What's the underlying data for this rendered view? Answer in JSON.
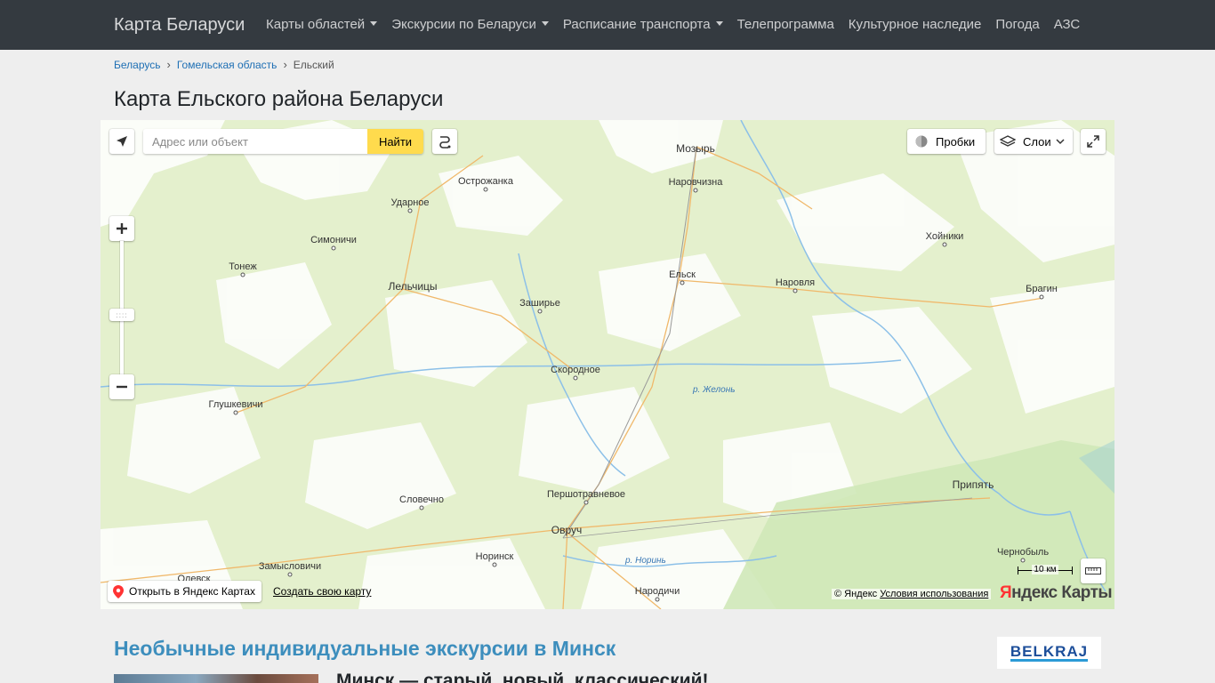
{
  "navbar": {
    "brand": "Карта Беларуси",
    "items": [
      {
        "label": "Карты областей",
        "dropdown": true
      },
      {
        "label": "Экскурсии по Беларуси",
        "dropdown": true
      },
      {
        "label": "Расписание транспорта",
        "dropdown": true
      },
      {
        "label": "Телепрограмма",
        "dropdown": false
      },
      {
        "label": "Культурное наследие",
        "dropdown": false
      },
      {
        "label": "Погода",
        "dropdown": false
      },
      {
        "label": "АЗС",
        "dropdown": false
      }
    ]
  },
  "breadcrumb": {
    "items": [
      "Беларусь",
      "Гомельская область"
    ],
    "current": "Ельский"
  },
  "page_title": "Карта Ельского района Беларуси",
  "map": {
    "search_placeholder": "Адрес или объект",
    "search_button": "Найти",
    "traffic_label": "Пробки",
    "layers_label": "Слои",
    "open_in_yandex": "Открыть в Яндекс Картах",
    "create_map": "Создать свою карту",
    "scale_label": "10 км",
    "copyright": "© Яндекс",
    "terms": "Условия использования",
    "logo_y": "Я",
    "logo_rest": "ндекс Карты",
    "places": [
      {
        "name": "Мозырь",
        "major": true
      },
      {
        "name": "Наровчизна",
        "major": false
      },
      {
        "name": "Остро­жанка",
        "major": false
      },
      {
        "name": "Ударное",
        "major": false
      },
      {
        "name": "Симоничи",
        "major": false
      },
      {
        "name": "Тонеж",
        "major": false
      },
      {
        "name": "Лельчицы",
        "major": true
      },
      {
        "name": "Заширье",
        "major": false
      },
      {
        "name": "Ельск",
        "major": false
      },
      {
        "name": "Наровля",
        "major": false
      },
      {
        "name": "Хойники",
        "major": false
      },
      {
        "name": "Брагин",
        "major": false
      },
      {
        "name": "Скородное",
        "major": false
      },
      {
        "name": "Глушкевичи",
        "major": false
      },
      {
        "name": "Словечно",
        "major": false
      },
      {
        "name": "Першотравневое",
        "major": false
      },
      {
        "name": "Овруч",
        "major": true
      },
      {
        "name": "Норинск",
        "major": false
      },
      {
        "name": "Замысловичи",
        "major": false
      },
      {
        "name": "Олевск",
        "major": false
      },
      {
        "name": "Народичи",
        "major": false
      },
      {
        "name": "Припять",
        "major": true
      },
      {
        "name": "Чернобыль",
        "major": false
      }
    ],
    "rivers": [
      "р. Желонь",
      "р. Норинь"
    ]
  },
  "promo": {
    "title": "Необычные индивидуальные экскурсии в Минск",
    "subtitle": "Минск — старый, новый, классический!",
    "partner_logo": "BELKRAJ"
  }
}
